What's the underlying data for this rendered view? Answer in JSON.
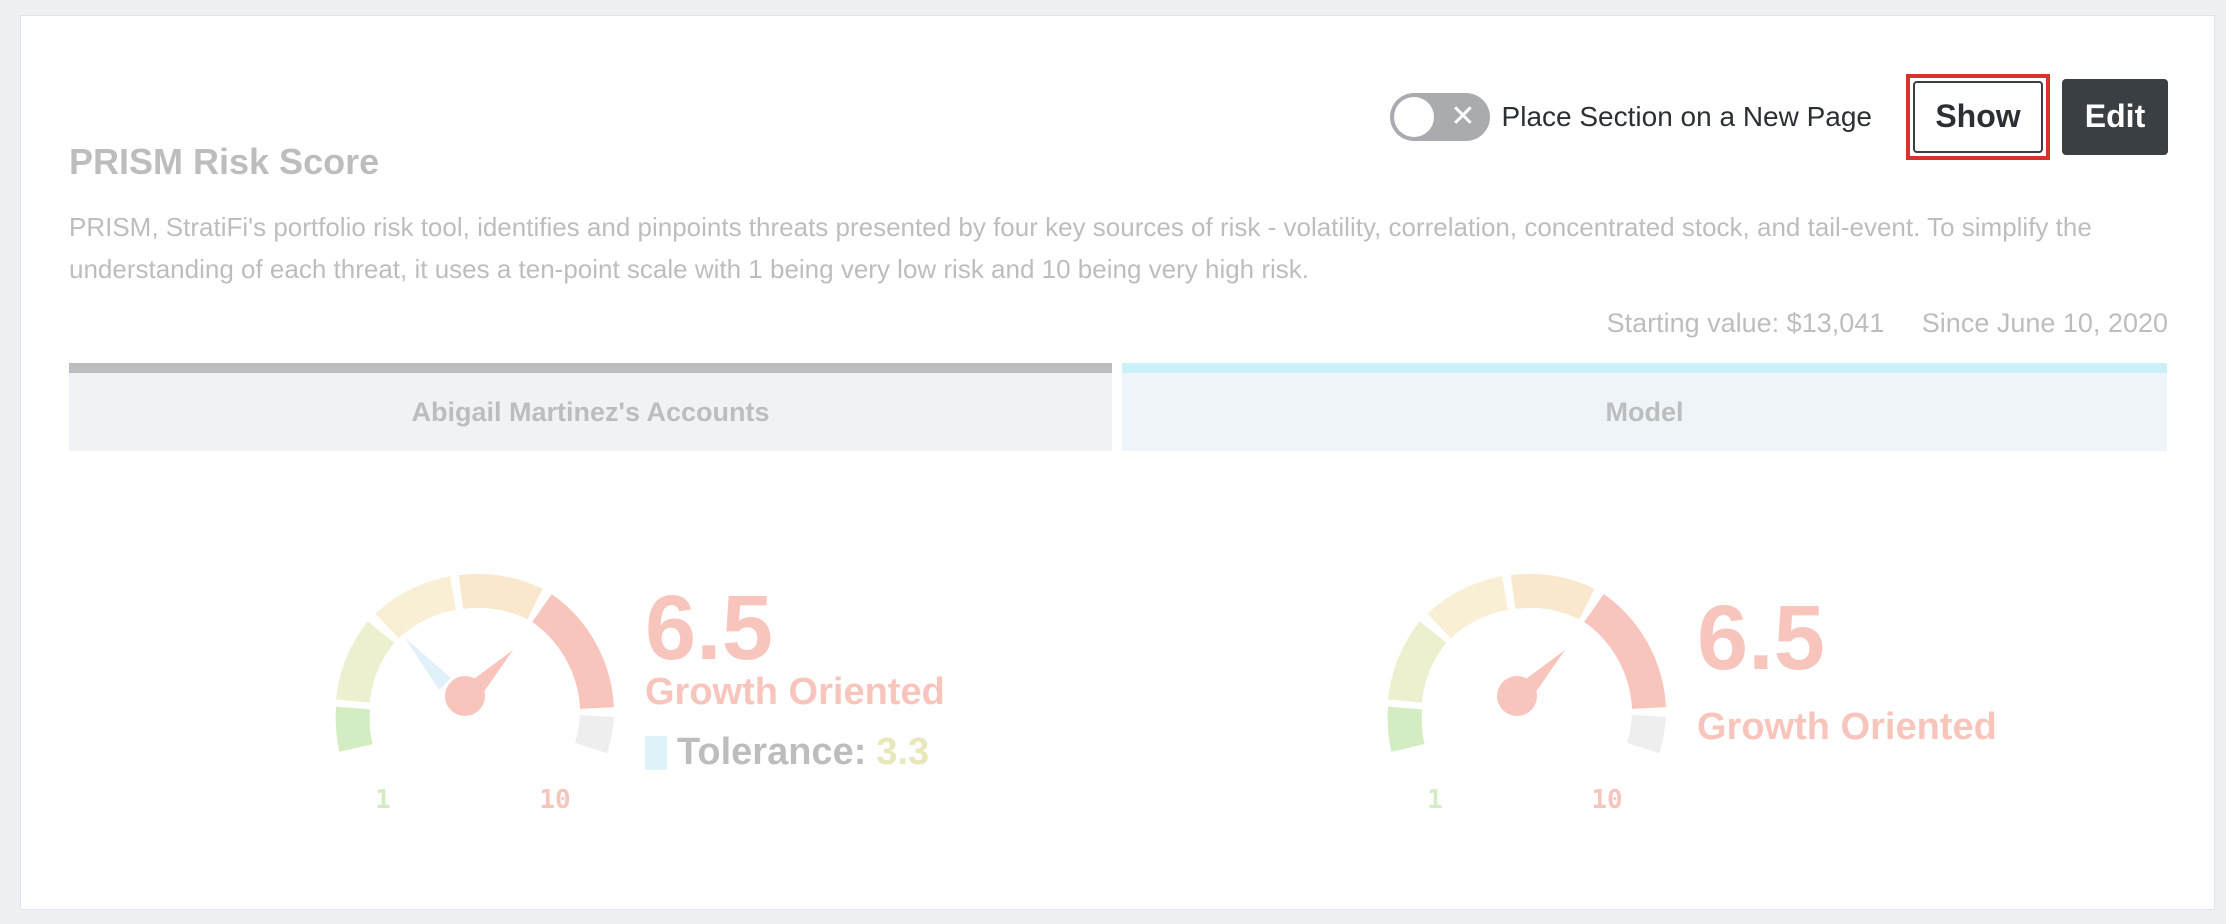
{
  "toolbar": {
    "toggle_label": "Place Section on a New Page",
    "toggle_on": false,
    "show_label": "Show",
    "edit_label": "Edit"
  },
  "section": {
    "title": "PRISM Risk Score",
    "description": "PRISM, StratiFi's portfolio risk tool, identifies and pinpoints threats presented by four key sources of risk - volatility, correlation, concentrated stock, and tail-event. To simplify the understanding of each threat, it uses a ten-point scale with 1 being very low risk and 10 being very high risk.",
    "starting_value": "Starting value: $13,041",
    "since": "Since June 10, 2020"
  },
  "tabs": {
    "accounts": "Abigail Martinez's Accounts",
    "model": "Model"
  },
  "accounts_gauge": {
    "score": "6.5",
    "label": "Growth Oriented",
    "tolerance_label": "Tolerance:",
    "tolerance_value": "3.3",
    "min": "1",
    "max": "10"
  },
  "model_gauge": {
    "score": "6.5",
    "label": "Growth Oriented",
    "min": "1",
    "max": "10"
  },
  "colors": {
    "highlight": "#d9312b",
    "score": "#e8492f",
    "tolerance": "#b8b52a",
    "dark_button": "#3a3f44"
  }
}
